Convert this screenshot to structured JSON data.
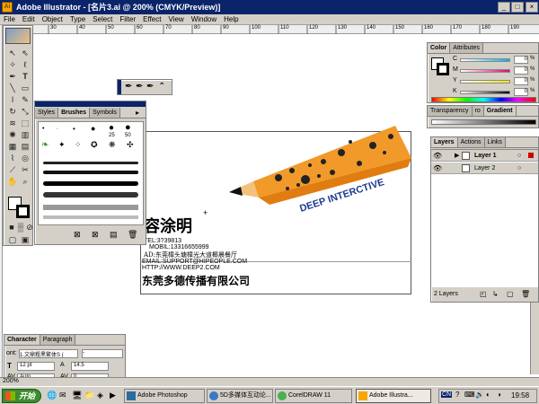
{
  "window": {
    "title": "Adobe Illustrator - [名片3.ai @ 200% (CMYK/Preview)]",
    "controls": [
      "_",
      "□",
      "×"
    ]
  },
  "menu": [
    "File",
    "Edit",
    "Object",
    "Type",
    "Select",
    "Filter",
    "Effect",
    "View",
    "Window",
    "Help"
  ],
  "ruler": {
    "labels": [
      "30",
      "40",
      "50",
      "60",
      "70",
      "80",
      "90",
      "100",
      "110",
      "120",
      "130",
      "140",
      "150",
      "160",
      "170",
      "180",
      "190"
    ]
  },
  "styles_panel": {
    "tabs": [
      "Styles",
      "Brushes",
      "Symbols"
    ],
    "sizes": [
      "25",
      "50"
    ]
  },
  "color_panel": {
    "tabs": [
      "Color",
      "Attributes"
    ],
    "channels": [
      {
        "label": "C",
        "value": "0",
        "unit": "%",
        "color": "#00b4e6"
      },
      {
        "label": "M",
        "value": "0",
        "unit": "%",
        "color": "#e6007e"
      },
      {
        "label": "Y",
        "value": "0",
        "unit": "%",
        "color": "#ffe600"
      },
      {
        "label": "K",
        "value": "0",
        "unit": "%",
        "color": "#000000"
      }
    ]
  },
  "transparency_panel": {
    "tabs": [
      "Transparency",
      "ro",
      "Gradient"
    ]
  },
  "layers_panel": {
    "tabs": [
      "Layers",
      "Actions",
      "Links"
    ],
    "layers": [
      {
        "name": "Layer 1",
        "selected": true
      },
      {
        "name": "Layer 2",
        "selected": false
      }
    ],
    "footer": "2 Layers"
  },
  "character_panel": {
    "tabs": [
      "Character",
      "Paragraph"
    ],
    "font_label": "ont:",
    "font_value": "1.文鼎粗黑繁体S (",
    "style_value": "-",
    "size_value": "12 pt",
    "leading_value": "14.5",
    "kerning_value": "Auto",
    "tracking_value": "0"
  },
  "card": {
    "brand": "DEEP INTERCTIVE",
    "name": "容涂明",
    "tel": "TEL:3?39813",
    "mobil": "MOBIL:13316655999",
    "addr": "AD:东莞樟头塘樟光大道椰晨餐厅",
    "email": "EMAIL:SUPPORT@HIPEOPLE.COM",
    "http": "HTTP://WWW.DEEP2.COM",
    "company": "东莞多德传播有限公司"
  },
  "status": {
    "zoom": "200%"
  },
  "taskbar": {
    "start": "开始",
    "tasks": [
      "Adobe Photoshop",
      "5D多媒体互动论...",
      "CorelDRAW 11",
      "Adobe Illustra..."
    ],
    "ime": "CN",
    "time": "19:58"
  }
}
